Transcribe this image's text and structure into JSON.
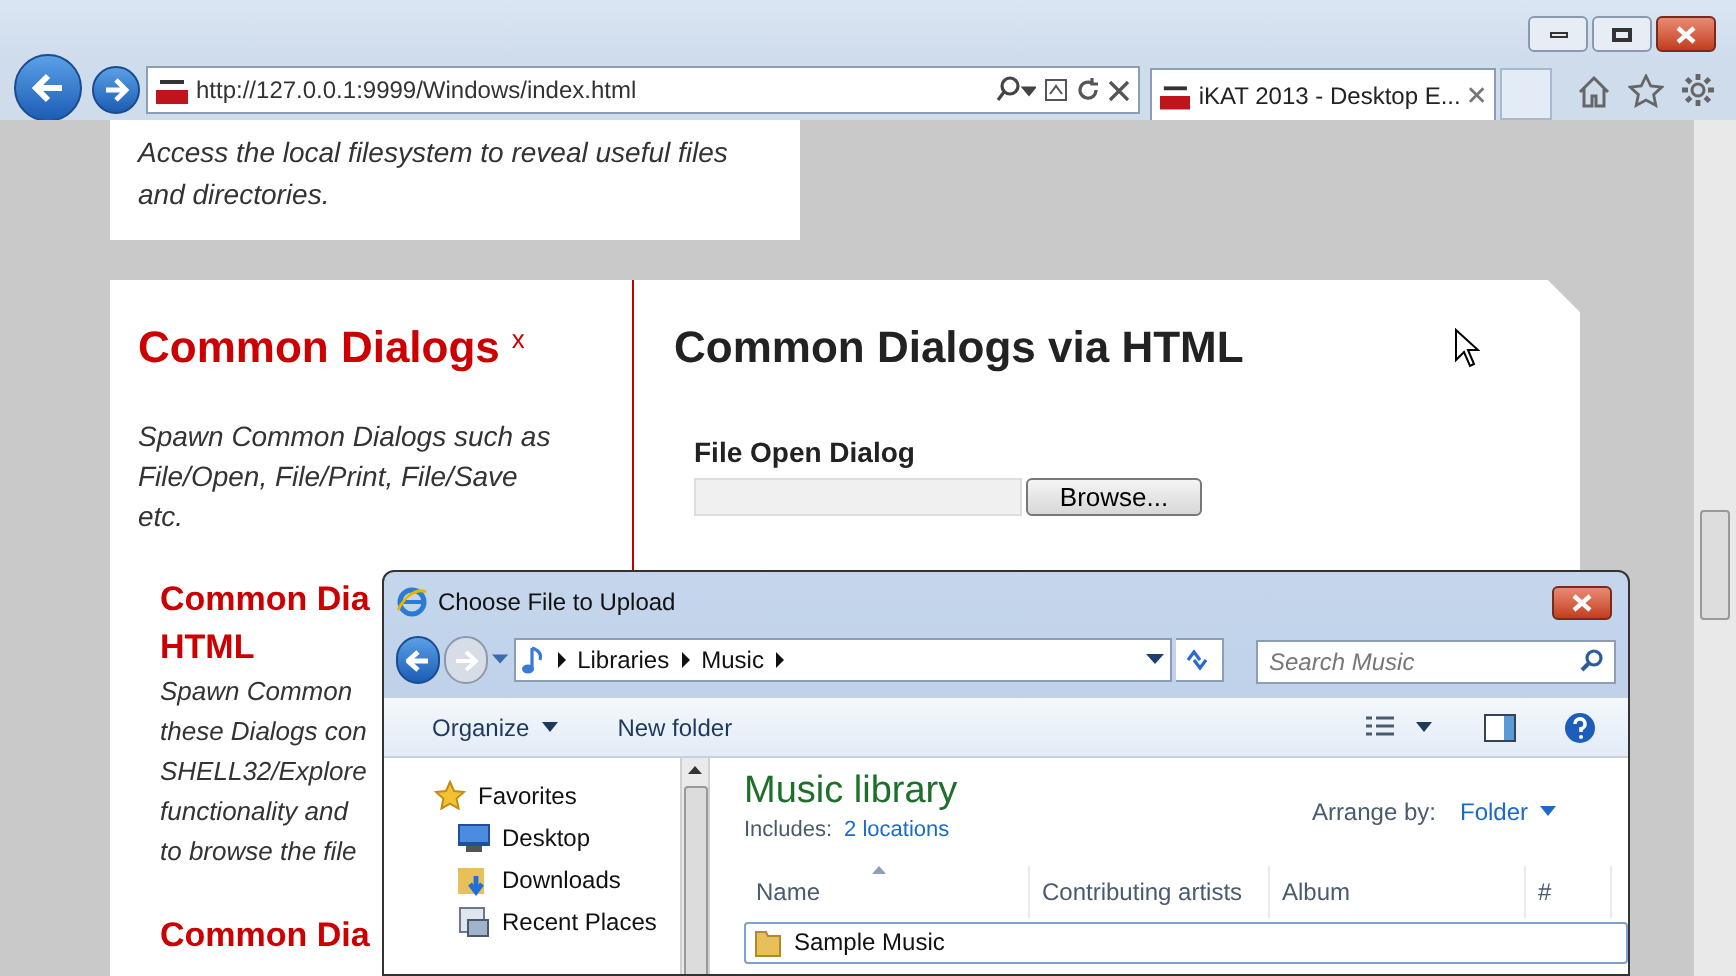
{
  "browser": {
    "address": "http://127.0.0.1:9999/Windows/index.html",
    "tabs": [
      {
        "label": "iKAT 2013 - Desktop E...",
        "selected": true
      }
    ]
  },
  "page": {
    "intro_text": "Access the local filesystem to reveal useful files and directories.",
    "section_title": "Common Dialogs",
    "close_mark": "x",
    "section_text": "Spawn Common Dialogs such as File/Open, File/Print, File/Save etc.",
    "sub_items": [
      {
        "title_lines": [
          "Common Dia",
          "HTML"
        ],
        "text_lines": [
          "Spawn Common",
          "these Dialogs con",
          "SHELL32/Explore",
          "functionality and",
          "to browse the file"
        ]
      },
      {
        "title_lines": [
          "Common Dia"
        ]
      }
    ],
    "main_title": "Common Dialogs via HTML",
    "field_label": "File Open Dialog",
    "browse_button": "Browse..."
  },
  "dialog": {
    "title": "Choose File to Upload",
    "breadcrumb": [
      "Libraries",
      "Music"
    ],
    "search_placeholder": "Search Music",
    "toolbar": [
      {
        "label": "Organize",
        "kind": "menu"
      },
      {
        "label": "New folder",
        "kind": "plain"
      }
    ],
    "nav_items": [
      {
        "label": "Favorites",
        "kind": "favorites"
      },
      {
        "label": "Desktop",
        "kind": "desktop"
      },
      {
        "label": "Downloads",
        "kind": "downloads"
      },
      {
        "label": "Recent Places",
        "kind": "recent"
      }
    ],
    "library_title": "Music library",
    "includes_label": "Includes:",
    "includes_link": "2 locations",
    "arrange_label": "Arrange by:",
    "arrange_value": "Folder",
    "columns": [
      "Name",
      "Contributing artists",
      "Album",
      "#"
    ],
    "rows": [
      {
        "name": "Sample Music",
        "selected": true
      }
    ]
  }
}
